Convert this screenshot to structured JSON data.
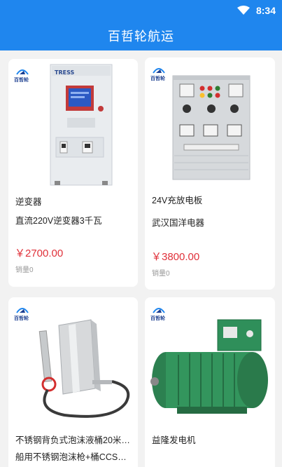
{
  "status_bar": {
    "time": "8:34",
    "wifi_icon": "wifi-icon"
  },
  "app_bar": {
    "title": "百哲轮航运"
  },
  "brand": {
    "logo_text": "百哲轮",
    "accent": "#1f86ee",
    "price_color": "#e0313a"
  },
  "products": [
    {
      "title": "逆变器",
      "subtitle": "直流220V逆变器3千瓦",
      "price": "￥2700.00",
      "sales": "销量0",
      "image": "inverter-cabinet"
    },
    {
      "title": "24V充放电板",
      "subtitle": "武汉国洋电器",
      "price": "￥3800.00",
      "sales": "销量0",
      "image": "charge-discharge-panel"
    },
    {
      "title": "不锈钢背负式泡沫液桶20米…",
      "subtitle": "船用不锈钢泡沫枪+桶CCS证书",
      "image": "foam-tank"
    },
    {
      "title": "益隆发电机",
      "image": "generator"
    }
  ]
}
